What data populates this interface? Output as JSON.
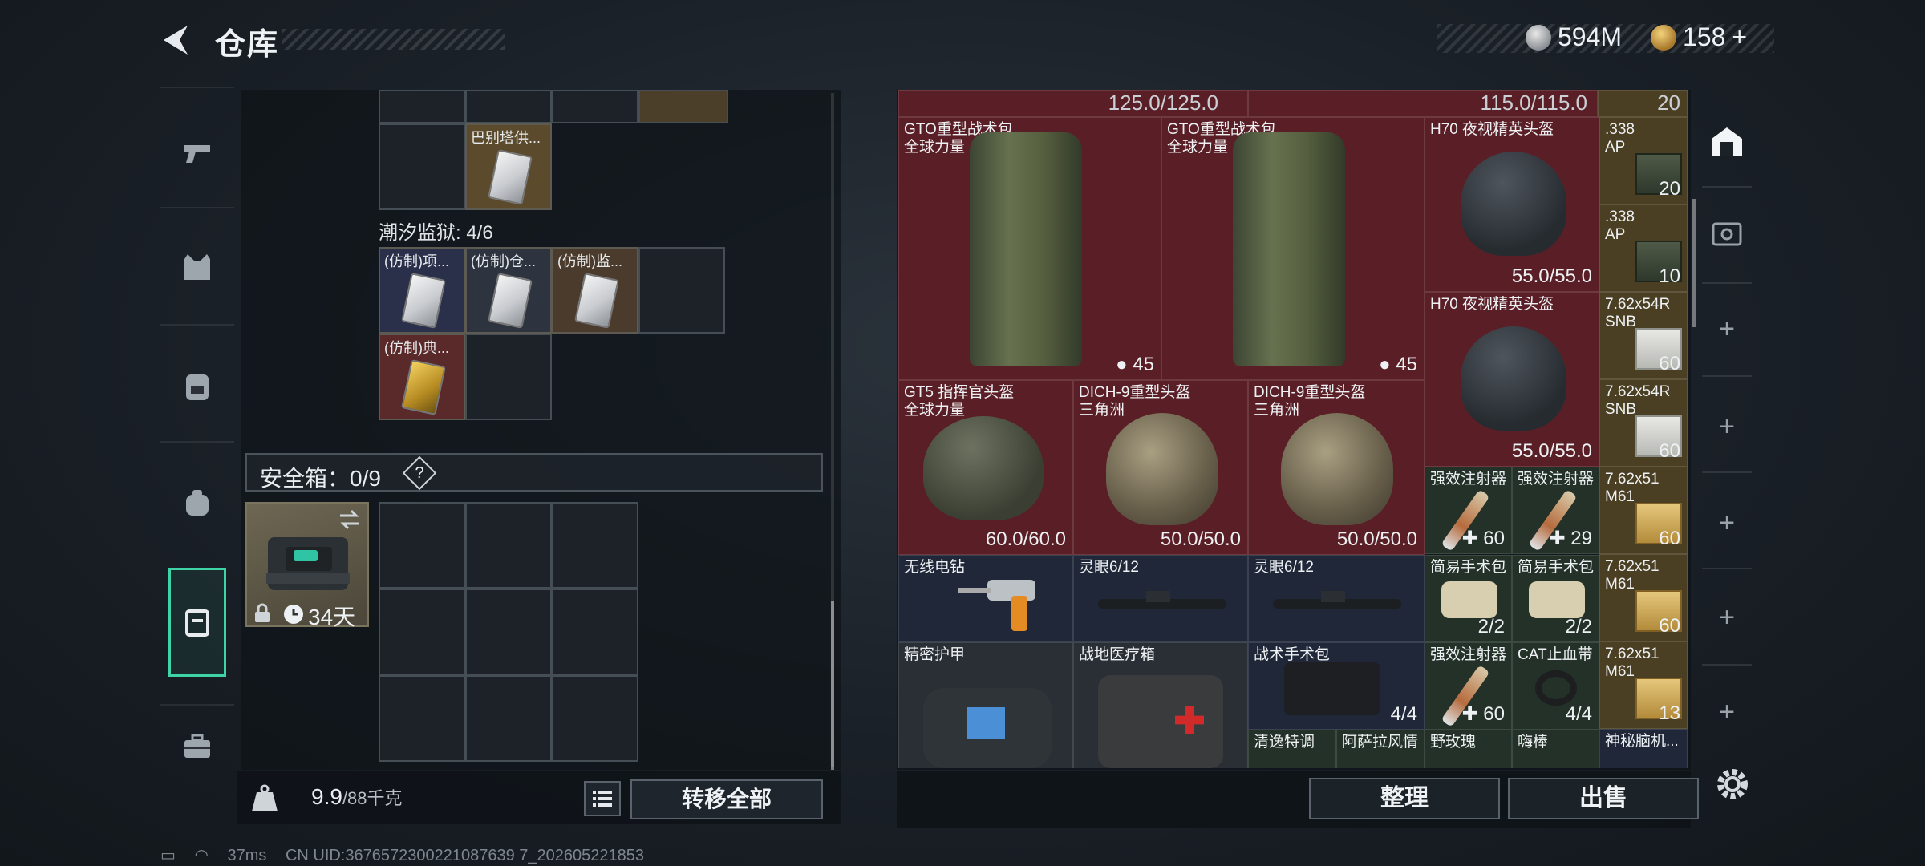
{
  "header": {
    "title": "仓库"
  },
  "currency": {
    "silver": "594M",
    "gold": "158",
    "gold_plus": "+"
  },
  "left_nav": [
    "pistol-icon",
    "vest-icon",
    "backpack-icon",
    "bag-icon",
    "safebox-icon",
    "toolbox-icon"
  ],
  "left_panel": {
    "top_item_label": "巴别塔供...",
    "section_label": "潮汐监狱: 4/6",
    "prison_items": [
      "(仿制)项...",
      "(仿制)仓...",
      "(仿制)监...",
      "(仿制)典..."
    ],
    "safebox_title": "安全箱：0/9",
    "safebox_help": "?",
    "safebox_days": "34天"
  },
  "weight": {
    "value": "9.9",
    "unit": "/88千克"
  },
  "buttons": {
    "transfer_all": "转移全部",
    "organize": "整理",
    "sell": "出售"
  },
  "right_panel": {
    "top_values": [
      "125.0/125.0",
      "115.0/115.0",
      "20"
    ],
    "items": {
      "bag1": {
        "name": "GTO重型战术包",
        "sub": "全球力量",
        "count": "45"
      },
      "bag2": {
        "name": "GTO重型战术包",
        "sub": "全球力量",
        "count": "45"
      },
      "h70a": {
        "name": "H70 夜视精英头盔",
        "dur": "55.0/55.0"
      },
      "h70b": {
        "name": "H70 夜视精英头盔",
        "dur": "55.0/55.0"
      },
      "ammo1": {
        "name": ".338",
        "sub": "AP",
        "count": "20"
      },
      "ammo2": {
        "name": ".338",
        "sub": "AP",
        "count": "10"
      },
      "ammo3": {
        "name": "7.62x54R",
        "sub": "SNB",
        "count": "60"
      },
      "ammo4": {
        "name": "7.62x54R",
        "sub": "SNB",
        "count": "60"
      },
      "ammo5": {
        "name": "7.62x51",
        "sub": "M61",
        "count": "60"
      },
      "ammo6": {
        "name": "7.62x51",
        "sub": "M61",
        "count": "60"
      },
      "ammo7": {
        "name": "7.62x51",
        "sub": "M61",
        "count": "13"
      },
      "gt5": {
        "name": "GT5 指挥官头盔",
        "sub": "全球力量",
        "dur": "60.0/60.0"
      },
      "dich1": {
        "name": "DICH-9重型头盔",
        "sub": "三角洲",
        "dur": "50.0/50.0"
      },
      "dich2": {
        "name": "DICH-9重型头盔",
        "sub": "三角洲",
        "dur": "50.0/50.0"
      },
      "inj1": {
        "name": "强效注射器",
        "count": "60"
      },
      "inj2": {
        "name": "强效注射器",
        "count": "29"
      },
      "inj3": {
        "name": "强效注射器",
        "count": "60"
      },
      "drill": {
        "name": "无线电钻"
      },
      "scope1": {
        "name": "灵眼6/12"
      },
      "scope2": {
        "name": "灵眼6/12"
      },
      "surg1": {
        "name": "简易手术包",
        "count": "2/2"
      },
      "surg2": {
        "name": "简易手术包",
        "count": "2/2"
      },
      "armor": {
        "name": "精密护甲"
      },
      "medbox": {
        "name": "战地医疗箱"
      },
      "tacsurg": {
        "name": "战术手术包",
        "count": "4/4"
      },
      "cat": {
        "name": "CAT止血带",
        "count": "4/4"
      },
      "misc1": {
        "name": "清逸特调"
      },
      "misc2": {
        "name": "阿萨拉风情"
      },
      "misc3": {
        "name": "野玫瑰"
      },
      "misc4": {
        "name": "嗨棒"
      },
      "misc5": {
        "name": "神秘脑机..."
      }
    }
  },
  "right_nav": [
    "safehouse-icon",
    "vault-icon",
    "+",
    "+",
    "+",
    "+",
    "+"
  ],
  "status": {
    "ping": "37ms",
    "uid": "CN UID:3676572300221087639 7_202605221853"
  }
}
